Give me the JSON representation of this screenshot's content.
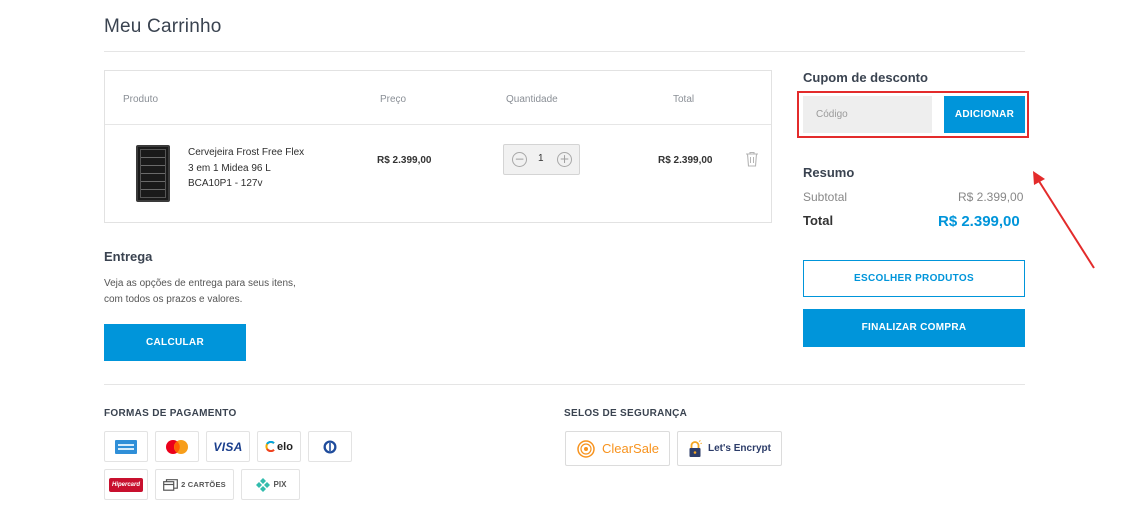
{
  "page": {
    "title": "Meu Carrinho"
  },
  "cart": {
    "headers": {
      "produto": "Produto",
      "preco": "Preço",
      "quantidade": "Quantidade",
      "total": "Total"
    },
    "items": [
      {
        "name_lines": [
          "Cervejeira Frost Free Flex",
          "3 em 1 Midea 96 L",
          "BCA10P1 - 127v"
        ],
        "price": "R$ 2.399,00",
        "quantity": "1",
        "total": "R$ 2.399,00",
        "image_icon": "beer-fridge-image",
        "remove_icon": "trash-icon"
      }
    ]
  },
  "entrega": {
    "title": "Entrega",
    "text_lines": [
      "Veja as opções de entrega para seus itens,",
      "com todos os prazos e valores."
    ],
    "button": "CALCULAR"
  },
  "cupom": {
    "title": "Cupom de desconto",
    "placeholder": "Código",
    "button": "ADICIONAR"
  },
  "resumo": {
    "title": "Resumo",
    "subtotal_label": "Subtotal",
    "subtotal_value": "R$ 2.399,00",
    "total_label": "Total",
    "total_value": "R$ 2.399,00"
  },
  "actions": {
    "escolher": "ESCOLHER PRODUTOS",
    "finalizar": "FINALIZAR COMPRA"
  },
  "footer": {
    "formas_title": "FORMAS DE PAGAMENTO",
    "payments": [
      {
        "icon": "amex-icon"
      },
      {
        "icon": "mastercard-icon"
      },
      {
        "icon": "visa-icon",
        "text": "VISA"
      },
      {
        "icon": "elo-icon",
        "text": "elo"
      },
      {
        "icon": "diners-icon"
      },
      {
        "icon": "hipercard-icon",
        "text": "Hipercard"
      },
      {
        "icon": "two-cards-icon",
        "text": "2 CARTÕES"
      },
      {
        "icon": "pix-icon",
        "text": "PIX"
      }
    ],
    "selos_title": "SELOS DE SEGURANÇA",
    "seals": [
      {
        "icon": "clearsale-icon",
        "text": "ClearSale"
      },
      {
        "icon": "lets-encrypt-icon",
        "text": "Let's Encrypt"
      }
    ]
  },
  "colors": {
    "accent": "#0095da",
    "annotation": "#e32b2b",
    "title": "#3a4350"
  }
}
